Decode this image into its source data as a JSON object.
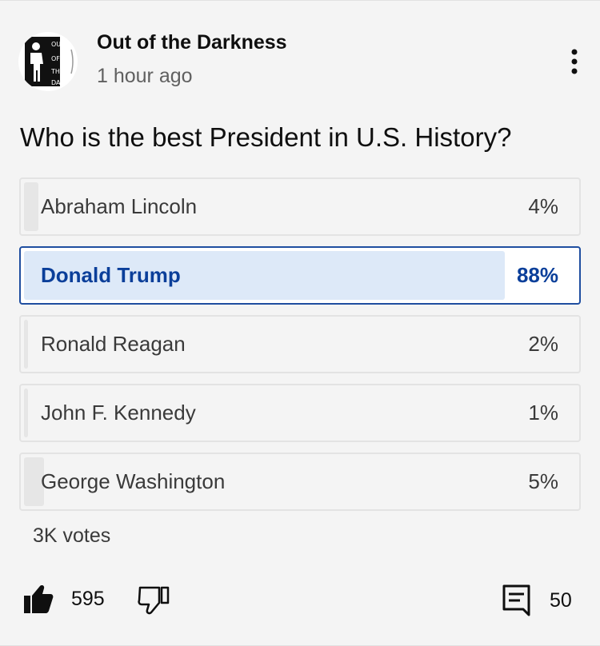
{
  "post": {
    "channel_name": "Out of the Darkness",
    "timestamp": "1 hour ago",
    "avatar_text": [
      "OUT",
      "OF",
      "THE",
      "DARK"
    ]
  },
  "poll": {
    "question": "Who is the best President in U.S. History?",
    "options": [
      {
        "label": "Abraham Lincoln",
        "percent_text": "4%",
        "percent": 4,
        "selected": false
      },
      {
        "label": "Donald Trump",
        "percent_text": "88%",
        "percent": 88,
        "selected": true
      },
      {
        "label": "Ronald Reagan",
        "percent_text": "2%",
        "percent": 2,
        "selected": false
      },
      {
        "label": "John F. Kennedy",
        "percent_text": "1%",
        "percent": 1,
        "selected": false
      },
      {
        "label": "George Washington",
        "percent_text": "5%",
        "percent": 5,
        "selected": false
      }
    ],
    "votes": "3K votes"
  },
  "actions": {
    "likes": "595",
    "comments": "50",
    "icons": [
      "like-icon",
      "dislike-icon",
      "comment-icon",
      "more-vert-icon"
    ]
  },
  "colors": {
    "selected_border": "#1f4ea0",
    "selected_text": "#0b3f9a",
    "selected_fill": "#dde9f8",
    "card_background": "#f4f4f4"
  }
}
